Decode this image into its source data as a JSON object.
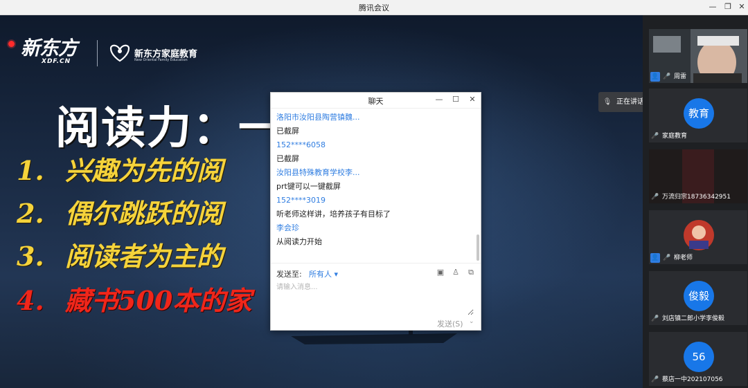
{
  "window": {
    "title": "腾讯会议"
  },
  "slide": {
    "logo_main": "新东方",
    "logo_sub": "XDF.CN",
    "logo_family": "新东方家庭教育",
    "logo_family_sub": "New Oriental Family Education",
    "title": "阅读力：一    的基石",
    "points": [
      {
        "num": "1.",
        "text": "兴趣为先的阅"
      },
      {
        "num": "2.",
        "text": "偶尔跳跃的阅"
      },
      {
        "num": "3.",
        "text": "阅读者为主的"
      },
      {
        "num": "4.",
        "text": "藏书500本的家"
      }
    ]
  },
  "chat": {
    "title": "聊天",
    "messages": [
      {
        "sender": "洛阳市汝阳县陶营镇魏...",
        "text": "已截屏"
      },
      {
        "sender": "152****6058",
        "text": "已截屏"
      },
      {
        "sender": "汝阳县特殊教育学校李...",
        "text": "prt键可以一键截屏"
      },
      {
        "sender": "152****3019",
        "text": "听老师这样讲，培养孩子有目标了"
      },
      {
        "sender": "李会珍",
        "text": "从阅读力开始"
      }
    ],
    "send_to_label": "发送至:",
    "send_to_value": "所有人 ▾",
    "input_placeholder": "请输入消息...",
    "send_button": "发送(S)"
  },
  "speaking": {
    "text": "正在讲话: 周雷;"
  },
  "participants": [
    {
      "name": "周雷",
      "avatar": ""
    },
    {
      "name": "家庭教育",
      "avatar": "教育"
    },
    {
      "name": "万流归宗18736342951",
      "avatar": ""
    },
    {
      "name": "柳老师",
      "avatar": ""
    },
    {
      "name": "刘店镇二郎小学李俊毅",
      "avatar": "俊毅"
    },
    {
      "name": "蔡店一中202107056",
      "avatar": "56"
    }
  ],
  "colors": {
    "accent": "#2f7de1",
    "point_yellow": "#f5d33b",
    "point_red": "#f0261a"
  }
}
